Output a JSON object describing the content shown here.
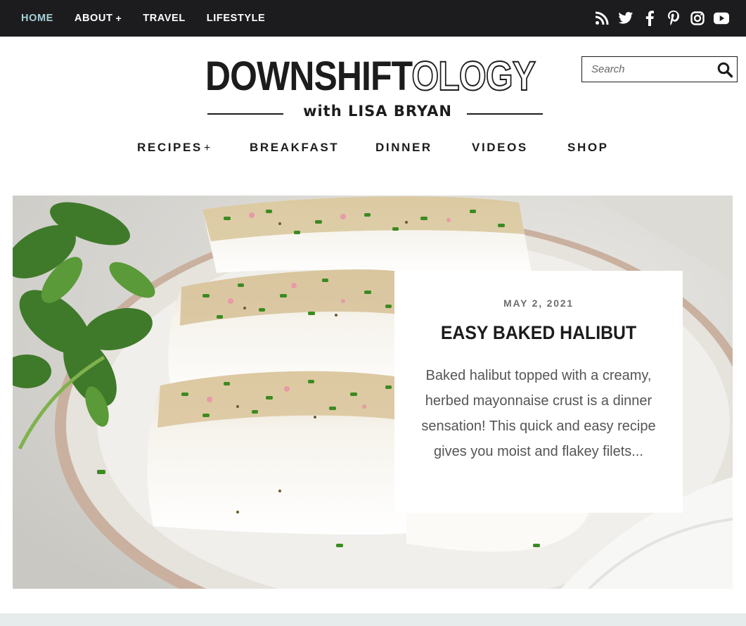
{
  "topnav": {
    "items": [
      {
        "label": "HOME",
        "plus": "",
        "active": true
      },
      {
        "label": "ABOUT",
        "plus": "+",
        "active": false
      },
      {
        "label": "TRAVEL",
        "plus": "",
        "active": false
      },
      {
        "label": "LIFESTYLE",
        "plus": "",
        "active": false
      }
    ],
    "social": [
      "rss-icon",
      "twitter-icon",
      "facebook-icon",
      "pinterest-icon",
      "instagram-icon",
      "youtube-icon"
    ]
  },
  "logo": {
    "main_dark": "DOWNSHIFT",
    "main_outline": "OLOGY",
    "subtitle": "with LISA BRYAN"
  },
  "search": {
    "placeholder": "Search",
    "value": ""
  },
  "mainnav": {
    "items": [
      {
        "label": "RECIPES",
        "plus": "+"
      },
      {
        "label": "BREAKFAST",
        "plus": ""
      },
      {
        "label": "DINNER",
        "plus": ""
      },
      {
        "label": "VIDEOS",
        "plus": ""
      },
      {
        "label": "SHOP",
        "plus": ""
      }
    ]
  },
  "featured": {
    "date": "MAY 2, 2021",
    "title": "EASY BAKED HALIBUT",
    "excerpt": "Baked halibut topped with a creamy, herbed mayonnaise crust is a dinner sensation! This quick and easy recipe gives you moist and flakey filets..."
  },
  "colors": {
    "topbar_bg": "#1c1c1e",
    "active_nav": "#a9cfd6",
    "text_dark": "#1c1c1c",
    "bottom_band": "#e6ebec"
  }
}
